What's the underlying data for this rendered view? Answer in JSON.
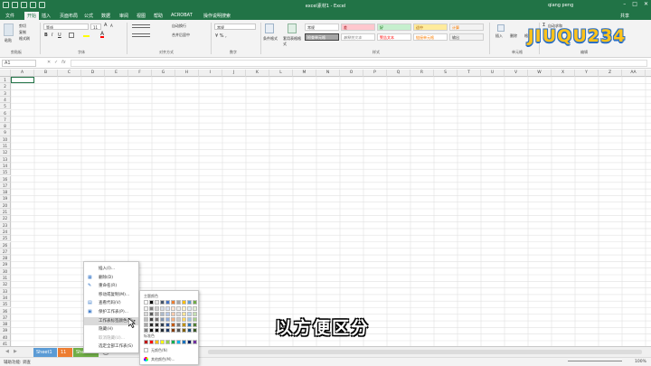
{
  "window": {
    "title": "excel素材1 - Excel",
    "user": "qiang peng",
    "share": "共享"
  },
  "tabs": [
    "文件",
    "开始",
    "插入",
    "页面布局",
    "公式",
    "数据",
    "审阅",
    "视图",
    "帮助",
    "ACROBAT",
    "操作说明搜索"
  ],
  "active_tab_index": 1,
  "ribbon": {
    "clipboard": {
      "paste": "粘贴",
      "cut": "剪切",
      "copy": "复制",
      "format_painter": "格式刷",
      "label": "剪贴板"
    },
    "font": {
      "name": "等线",
      "size": "11",
      "label": "字体"
    },
    "alignment": {
      "wrap": "自动换行",
      "merge": "合并后居中",
      "label": "对齐方式"
    },
    "number": {
      "format": "常规",
      "label": "数字"
    },
    "styles": {
      "conditional": "条件格式",
      "table": "套用表格格式",
      "label": "样式",
      "cells": [
        "常规",
        "差",
        "好",
        "适中",
        "计算",
        "检查单元格",
        "解释性文本",
        "警告文本",
        "链接单元格",
        "输出"
      ]
    },
    "cells": {
      "insert": "插入",
      "delete": "删除",
      "format": "格式",
      "label": "单元格"
    },
    "editing": {
      "autosum": "自动求和",
      "label": "编辑"
    }
  },
  "logo_text": "JIUQU234",
  "formula_bar": {
    "namebox": "A1",
    "fx": "fx",
    "value": ""
  },
  "columns": [
    "A",
    "B",
    "C",
    "D",
    "E",
    "F",
    "G",
    "H",
    "I",
    "J",
    "K",
    "L",
    "M",
    "N",
    "O",
    "P",
    "Q",
    "R",
    "S",
    "T",
    "U",
    "V",
    "W",
    "X",
    "Y",
    "Z",
    "AA",
    "AB"
  ],
  "row_count": 41,
  "context_menu": {
    "items": [
      {
        "label": "插入(I)...",
        "icon": "",
        "disabled": false
      },
      {
        "label": "删除(D)",
        "icon": "delete-icon",
        "disabled": false
      },
      {
        "label": "重命名(R)",
        "icon": "rename-icon",
        "disabled": false
      },
      {
        "label": "移动或复制(M)...",
        "icon": "",
        "disabled": false
      },
      {
        "label": "查看代码(V)",
        "icon": "code-icon",
        "disabled": false
      },
      {
        "label": "保护工作表(P)...",
        "icon": "protect-icon",
        "disabled": false
      },
      {
        "label": "工作表标签颜色(T)",
        "icon": "",
        "disabled": false,
        "highlight": true,
        "submenu": true
      },
      {
        "label": "隐藏(H)",
        "icon": "",
        "disabled": false
      },
      {
        "label": "取消隐藏(U)...",
        "icon": "",
        "disabled": true
      },
      {
        "label": "选定全部工作表(S)",
        "icon": "",
        "disabled": false
      }
    ]
  },
  "color_popup": {
    "theme_label": "主题颜色",
    "standard_label": "标准色",
    "no_color": "无颜色(N)",
    "more_colors": "其他颜色(M)...",
    "theme_colors": [
      "#ffffff",
      "#000000",
      "#e7e6e6",
      "#44546a",
      "#4472c4",
      "#ed7d31",
      "#a5a5a5",
      "#ffc000",
      "#5b9bd5",
      "#70ad47"
    ],
    "shade_colors": [
      [
        "#f2f2f2",
        "#7f7f7f",
        "#d0cece",
        "#d6dce4",
        "#d9e2f3",
        "#fbe5d5",
        "#ededed",
        "#fff2cc",
        "#deebf6",
        "#e2efd9"
      ],
      [
        "#d8d8d8",
        "#595959",
        "#aeabab",
        "#adb9ca",
        "#b4c6e7",
        "#f7cbac",
        "#dbdbdb",
        "#fee599",
        "#bdd7ee",
        "#c5e0b3"
      ],
      [
        "#bfbfbf",
        "#3f3f3f",
        "#757070",
        "#8496b0",
        "#8eaadb",
        "#f4b183",
        "#c9c9c9",
        "#ffd965",
        "#9cc3e5",
        "#a8d08d"
      ],
      [
        "#a5a5a5",
        "#262626",
        "#3a3838",
        "#323f4f",
        "#2f5496",
        "#c55a11",
        "#7b7b7b",
        "#bf9000",
        "#2e75b5",
        "#538135"
      ],
      [
        "#7f7f7f",
        "#0c0c0c",
        "#171616",
        "#222a35",
        "#1f3864",
        "#833c0b",
        "#525252",
        "#7f6000",
        "#1e4e79",
        "#375623"
      ]
    ],
    "standard_colors": [
      "#c00000",
      "#ff0000",
      "#ffc000",
      "#ffff00",
      "#92d050",
      "#00b050",
      "#00b0f0",
      "#0070c0",
      "#002060",
      "#7030a0"
    ]
  },
  "sheets": [
    {
      "label": "Sheet1",
      "color": "#5b9bd5"
    },
    {
      "label": "11",
      "color": "#ed7d31"
    },
    {
      "label": "Sheet...",
      "color": "#70ad47"
    }
  ],
  "status": {
    "left": "辅助功能: 调查",
    "zoom": "100%"
  },
  "subtitle": "以方便区分"
}
